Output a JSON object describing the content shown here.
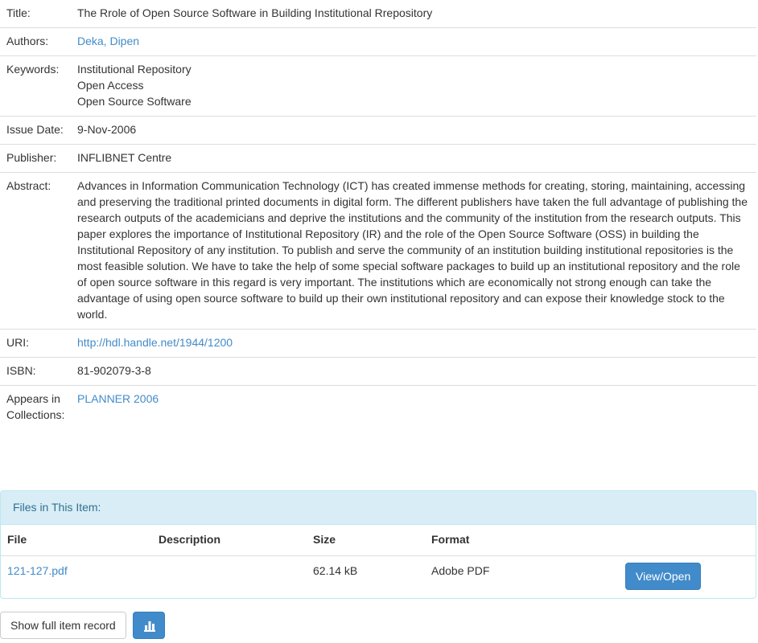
{
  "item": {
    "title_label": "Title:",
    "title": "The Rrole of Open Source Software in Building Institutional Rrepository",
    "authors_label": "Authors:",
    "author": "Deka, Dipen",
    "keywords_label": "Keywords:",
    "keywords": [
      "Institutional Repository",
      "Open Access",
      "Open Source Software"
    ],
    "issue_date_label": "Issue Date:",
    "issue_date": "9-Nov-2006",
    "publisher_label": "Publisher:",
    "publisher": "INFLIBNET Centre",
    "abstract_label": "Abstract:",
    "abstract": "Advances in Information Communication Technology (ICT) has created immense methods for creating, storing, maintaining, accessing and preserving the traditional printed documents in digital form. The different publishers have taken the full advantage of publishing the research outputs of the academicians and deprive the institutions and the community of the institution from the research outputs. This paper explores the importance of Institutional Repository (IR) and the role of the Open Source Software (OSS) in building the Institutional Repository of any institution. To publish and serve the community of an institution building institutional repositories is the most feasible solution. We have to take the help of some special software packages to build up an institutional repository and the role of open source software in this regard is very important. The institutions which are economically not strong enough can take the advantage of using open source software to build up their own institutional repository and can expose their knowledge stock to the world.",
    "uri_label": "URI:",
    "uri": "http://hdl.handle.net/1944/1200",
    "isbn_label": "ISBN:",
    "isbn": "81-902079-3-8",
    "collections_label": "Appears in Collections:",
    "collection": "PLANNER 2006"
  },
  "files": {
    "heading": "Files in This Item:",
    "columns": {
      "file": "File",
      "description": "Description",
      "size": "Size",
      "format": "Format"
    },
    "rows": [
      {
        "file": "121-127.pdf",
        "description": "",
        "size": "62.14 kB",
        "format": "Adobe PDF",
        "action": "View/Open"
      }
    ]
  },
  "actions": {
    "full_record": "Show full item record",
    "stats_icon": "bar-chart-icon"
  },
  "colors": {
    "link": "#428bca",
    "primary_button": "#428bca",
    "panel_heading_bg": "#d9edf7",
    "panel_heading_text": "#31708f"
  }
}
